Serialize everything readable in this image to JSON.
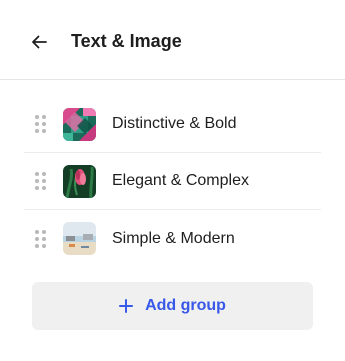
{
  "header": {
    "title": "Text & Image",
    "back_icon": "arrow-left-icon"
  },
  "groups": [
    {
      "label": "Distinctive & Bold",
      "thumb_icon": "pattern-thumbnail"
    },
    {
      "label": "Elegant & Complex",
      "thumb_icon": "flower-thumbnail"
    },
    {
      "label": "Simple & Modern",
      "thumb_icon": "beach-thumbnail"
    }
  ],
  "add_group": {
    "label": "Add group",
    "icon": "plus-icon"
  },
  "colors": {
    "accent": "#3858e9",
    "button_bg": "#f0f0f0",
    "divider": "#e6e6e6",
    "text": "#1e1e1e"
  }
}
